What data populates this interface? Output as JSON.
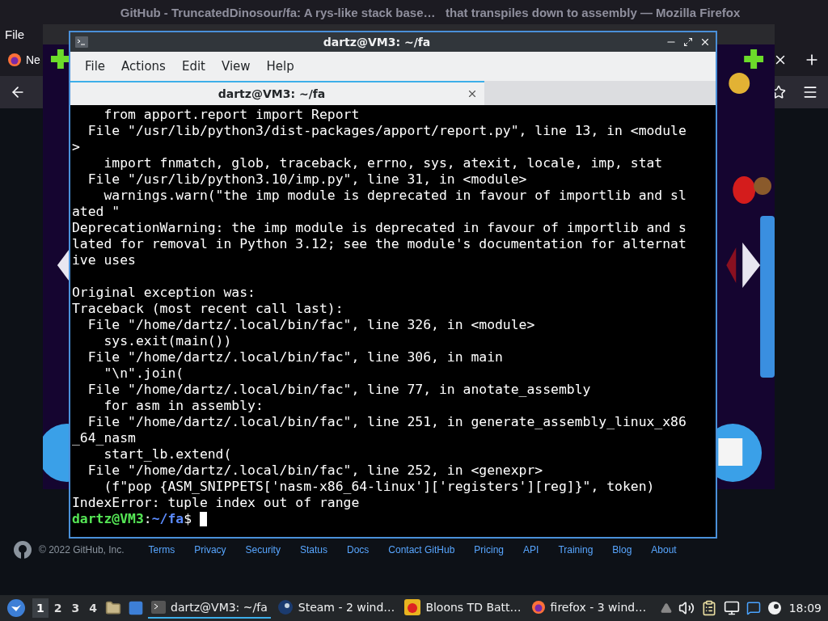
{
  "firefox": {
    "title": "GitHub - TruncatedDinosour/fa: A rys-like stack base…   that transpiles down to assembly — Mozilla Firefox",
    "menu": [
      "File"
    ],
    "tab": "Ne",
    "footer": {
      "copyright": "© 2022 GitHub, Inc.",
      "links": [
        "Terms",
        "Privacy",
        "Security",
        "Status",
        "Docs",
        "Contact GitHub",
        "Pricing",
        "API",
        "Training",
        "Blog",
        "About"
      ]
    }
  },
  "terminal": {
    "title": "dartz@VM3: ~/fa",
    "menu": [
      "File",
      "Actions",
      "Edit",
      "View",
      "Help"
    ],
    "tab": "dartz@VM3: ~/fa",
    "output": [
      [
        "    from apport.report import Report",
        "  File \"/usr/lib/python3/dist-packages/apport/report.py\", line 13, in <module",
        ">",
        "    import fnmatch, glob, traceback, errno, sys, atexit, locale, imp, stat",
        "  File \"/usr/lib/python3.10/imp.py\", line 31, in <module>",
        "    warnings.warn(\"the imp module is deprecated in favour of importlib and sl",
        "ated \"",
        "DeprecationWarning: the imp module is deprecated in favour of importlib and s",
        "lated for removal in Python 3.12; see the module's documentation for alternat",
        "ive uses"
      ],
      [
        "Original exception was:",
        "Traceback (most recent call last):",
        "  File \"/home/dartz/.local/bin/fac\", line 326, in <module>",
        "    sys.exit(main())",
        "  File \"/home/dartz/.local/bin/fac\", line 306, in main",
        "    \"\\n\".join(",
        "  File \"/home/dartz/.local/bin/fac\", line 77, in anotate_assembly",
        "    for asm in assembly:",
        "  File \"/home/dartz/.local/bin/fac\", line 251, in generate_assembly_linux_x86",
        "_64_nasm",
        "    start_lb.extend(",
        "  File \"/home/dartz/.local/bin/fac\", line 252, in <genexpr>",
        "    (f\"pop {ASM_SNIPPETS['nasm-x86_64-linux']['registers'][reg]}\", token)",
        "IndexError: tuple index out of range"
      ]
    ],
    "prompt": {
      "user_host": "dartz@VM3",
      "separator": ":",
      "path": "~/fa",
      "symbol": "$"
    }
  },
  "taskbar": {
    "workspaces": [
      {
        "label": "1",
        "selected": true
      },
      {
        "label": "2",
        "selected": false
      },
      {
        "label": "3",
        "selected": false
      },
      {
        "label": "4",
        "selected": false
      }
    ],
    "tasks": [
      {
        "kind": "terminal",
        "label": "dartz@VM3: ~/fa",
        "selected": true
      },
      {
        "kind": "steam",
        "label": "Steam - 2 wind…",
        "selected": false
      },
      {
        "kind": "game",
        "label": "Bloons TD Batt…",
        "selected": false
      },
      {
        "kind": "firefox",
        "label": "firefox - 3 wind…",
        "selected": false
      }
    ],
    "clock": "18:09"
  }
}
